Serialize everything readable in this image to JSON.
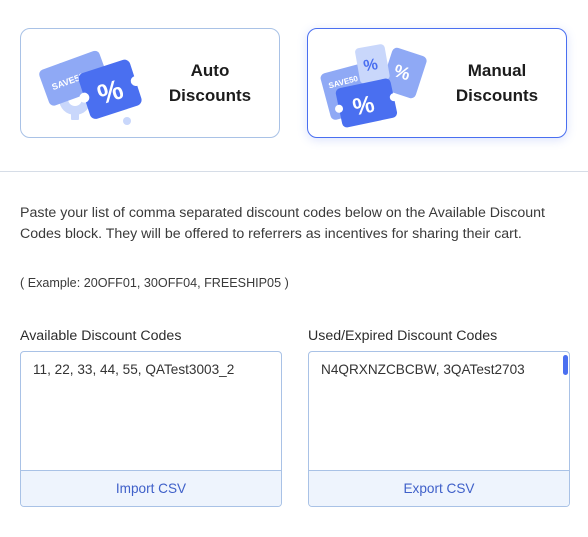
{
  "modes": {
    "auto": {
      "line1": "Auto",
      "line2": "Discounts"
    },
    "manual": {
      "line1": "Manual",
      "line2": "Discounts"
    },
    "selected": "manual"
  },
  "illustration": {
    "ticket_text_a": "SAVE50",
    "ticket_text_b": "%",
    "colors": {
      "primary": "#4a6ff0",
      "light": "#c9d7fb",
      "mid": "#8fa9f5"
    }
  },
  "description": "Paste your list of comma separated discount codes below on the Available Discount Codes block. They will be offered to referrers as incentives for sharing their cart.",
  "example": "( Example: 20OFF01, 30OFF04, FREESHIP05 )",
  "available": {
    "label": "Available Discount Codes",
    "value": "11, 22, 33, 44, 55, QATest3003_2",
    "action_label": "Import CSV"
  },
  "used": {
    "label": "Used/Expired Discount Codes",
    "value": "N4QRXNZCBCBW, 3QATest2703",
    "action_label": "Export CSV"
  },
  "theme": {
    "accent": "#4a6ff0",
    "border": "#a9c2e6",
    "action_bg": "#eef4fd",
    "action_text": "#3f60c9"
  }
}
